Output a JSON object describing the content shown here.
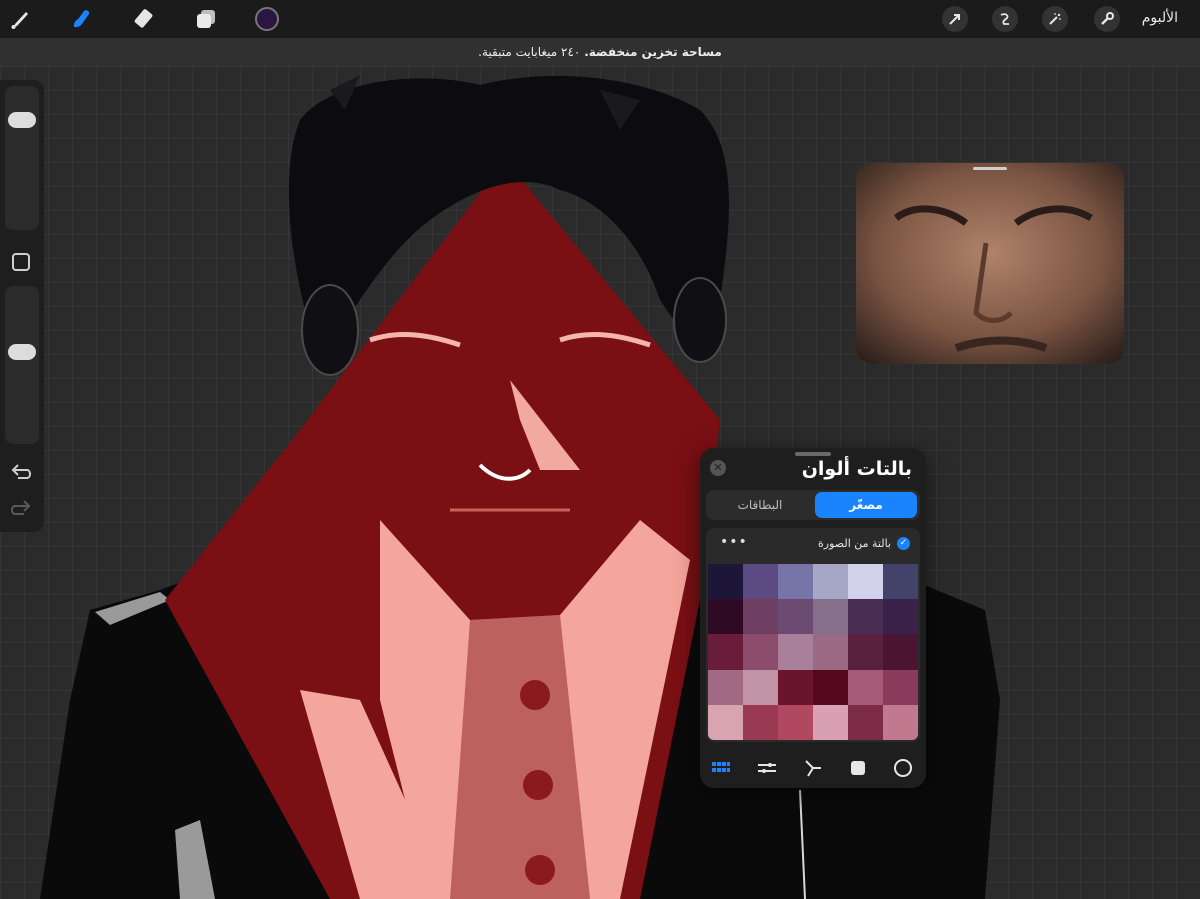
{
  "toolbar": {
    "gallery_label": "الألبوم",
    "tools": [
      {
        "name": "brush-icon",
        "active": false
      },
      {
        "name": "smudge-icon",
        "active": true
      },
      {
        "name": "eraser-icon",
        "active": false
      },
      {
        "name": "layers-icon",
        "active": false
      }
    ],
    "current_color": "#2a1640",
    "accent": "#1a84ff",
    "actions": [
      "wrench-icon",
      "magic-wand-icon",
      "selection-icon",
      "transform-arrow-icon"
    ]
  },
  "notification": {
    "bold": "مساحة تخزين منخفضة.",
    "detail": "٢٤٠ ميغابايت متبقية."
  },
  "palette_panel": {
    "title": "بالتات ألوان",
    "tabs": {
      "compact": "مصغّر",
      "cards": "البطاقات"
    },
    "palette_name": "بالتة من الصورة",
    "more_label": "•••",
    "swatches": [
      "#1d1638",
      "#5b4b82",
      "#7775a8",
      "#a6a6c6",
      "#d2d2ec",
      "#42426a",
      "#2e0a24",
      "#6e3e63",
      "#6c4a72",
      "#87708c",
      "#4a2d52",
      "#3a2148",
      "#6a1d3b",
      "#8c4c6b",
      "#a9809c",
      "#9a6a84",
      "#5a2040",
      "#4a1532",
      "#a26a82",
      "#c094a6",
      "#6a1430",
      "#55081e",
      "#a55a76",
      "#8a3a5a",
      "#d8a4b0",
      "#9a3a52",
      "#b04860",
      "#d9a0b4",
      "#7d2c48",
      "#c2788e"
    ],
    "bottom_icons": [
      "palettes-grid-icon",
      "sliders-icon",
      "harmony-icon",
      "square-icon",
      "disc-icon"
    ]
  },
  "sidebar": {
    "undo_icon": "undo-icon",
    "redo_icon": "redo-icon",
    "modify_icon": "square-modify-icon",
    "brush_size": 0.82,
    "opacity": 0.6
  }
}
